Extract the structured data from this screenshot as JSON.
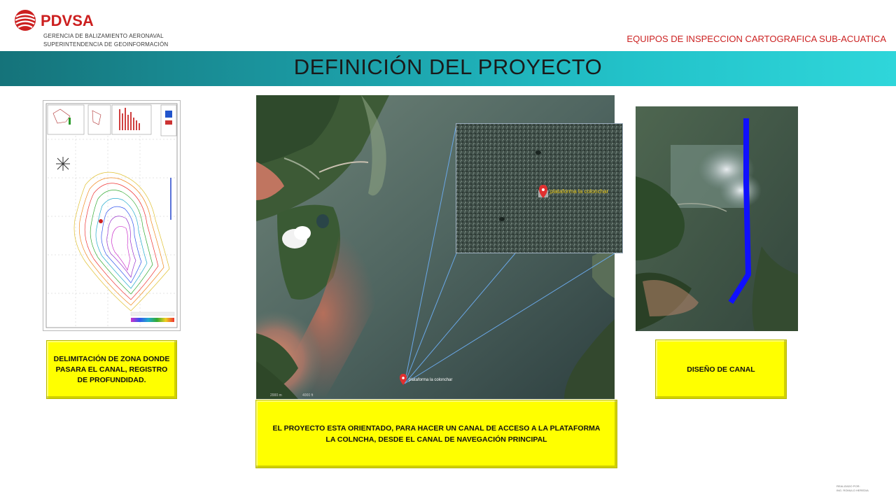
{
  "header": {
    "brand": "PDVSA",
    "subtitle_line1": "GERENCIA DE  BALIZAMIENTO AERONAVAL",
    "subtitle_line2": "SUPERINTENDENCIA DE GEOINFORMACIÓN",
    "top_right": "EQUIPOS DE INSPECCION CARTOGRAFICA SUB-ACUATICA",
    "brand_color": "#cc1f1f"
  },
  "title": "DEFINICIÓN DEL PROYECTO",
  "satellite": {
    "marker_label": "plataforma la colonchar",
    "inset_marker_label": "plataforma la colonchar",
    "scale_left": "2000 m",
    "scale_right": "4000 ft"
  },
  "boxes": {
    "left": "DELIMITACIÓN DE ZONA DONDE PASARA EL CANAL, REGISTRO DE PROFUNDIDAD.",
    "right": "DISEÑO DE CANAL",
    "center": "EL PROYECTO ESTA ORIENTADO, PARA HACER UN CANAL DE ACCESO A LA PLATAFORMA LA COLNCHA, DESDE EL CANAL DE NAVEGACIÓN PRINCIPAL"
  },
  "footer": {
    "line1": "REALIZADO POR:",
    "line2": "ING. ROMULO HEREDIA"
  },
  "colors": {
    "band_start": "#15737a",
    "band_end": "#2fd6da",
    "box_yellow": "#ffff00",
    "canal_blue": "#1010ff"
  }
}
